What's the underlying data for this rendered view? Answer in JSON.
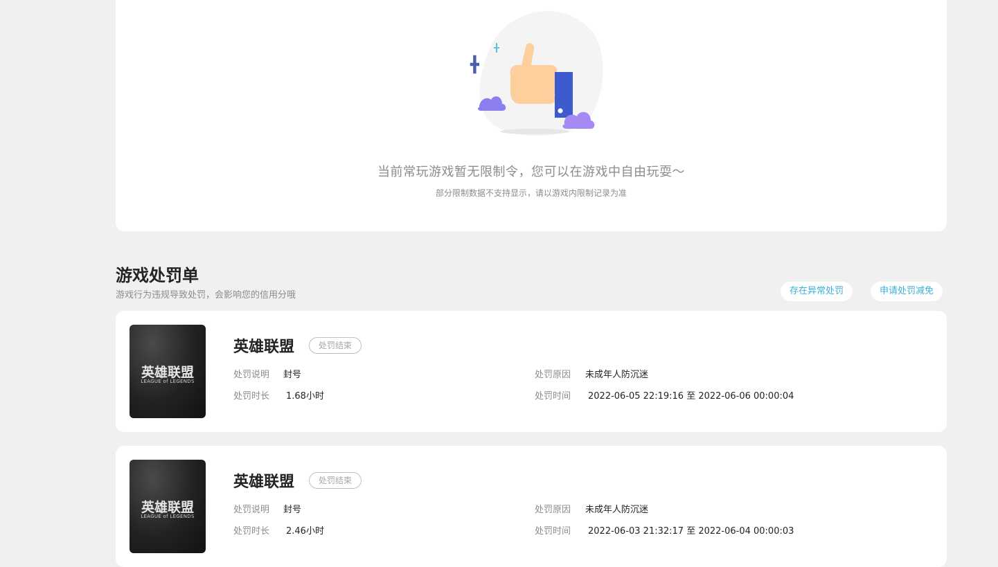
{
  "empty_state": {
    "title": "当前常玩游戏暂无限制令，您可以在游戏中自由玩耍～",
    "subtitle": "部分限制数据不支持显示，请以游戏内限制记录为准"
  },
  "punish_section": {
    "title": "游戏处罚单",
    "description": "游戏行为违规导致处罚，会影响您的信用分哦",
    "btn_abnormal": "存在异常处罚",
    "btn_reduce": "申请处罚减免"
  },
  "labels": {
    "desc": "处罚说明",
    "duration": "处罚时长",
    "reason": "处罚原因",
    "time": "处罚时间"
  },
  "records": [
    {
      "cover_title": "英雄联盟",
      "cover_sub": "LEAGUE of LEGENDS",
      "game": "英雄联盟",
      "status": "处罚结束",
      "desc": "封号",
      "duration": "1.68小时",
      "reason": "未成年人防沉迷",
      "time": "2022-06-05 22:19:16 至 2022-06-06 00:00:04"
    },
    {
      "cover_title": "英雄联盟",
      "cover_sub": "LEAGUE of LEGENDS",
      "game": "英雄联盟",
      "status": "处罚结束",
      "desc": "封号",
      "duration": "2.46小时",
      "reason": "未成年人防沉迷",
      "time": "2022-06-03 21:32:17 至 2022-06-04 00:00:03"
    }
  ]
}
